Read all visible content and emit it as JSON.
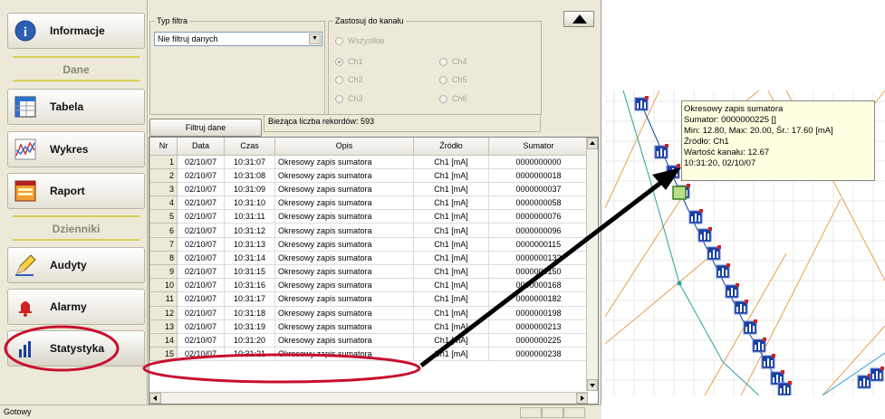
{
  "sidebar": {
    "info_label": "Informacje",
    "section_data": "Dane",
    "table_label": "Tabela",
    "chart_label": "Wykres",
    "report_label": "Raport",
    "section_logs": "Dzienniki",
    "audits_label": "Audyty",
    "alarms_label": "Alarmy",
    "stats_label": "Statystyka"
  },
  "filter": {
    "type_legend": "Typ filtra",
    "type_value": "Nie filtruj danych",
    "channel_legend": "Zastosuj do kanału",
    "all_label": "Wszystkie",
    "channels": [
      "Ch1",
      "Ch2",
      "Ch3",
      "Ch4",
      "Ch5",
      "Ch6"
    ],
    "apply_button": "Filtruj dane",
    "record_count": "Bieżąca liczba rekordów: 593"
  },
  "table": {
    "columns": [
      "Nr",
      "Data",
      "Czas",
      "Opis",
      "Źródło",
      "Sumator"
    ],
    "rows": [
      [
        "1",
        "02/10/07",
        "10:31:07",
        "Okresowy zapis sumatora",
        "Ch1 [mA]",
        "0000000000"
      ],
      [
        "2",
        "02/10/07",
        "10:31:08",
        "Okresowy zapis sumatora",
        "Ch1 [mA]",
        "0000000018"
      ],
      [
        "3",
        "02/10/07",
        "10:31:09",
        "Okresowy zapis sumatora",
        "Ch1 [mA]",
        "0000000037"
      ],
      [
        "4",
        "02/10/07",
        "10:31:10",
        "Okresowy zapis sumatora",
        "Ch1 [mA]",
        "0000000058"
      ],
      [
        "5",
        "02/10/07",
        "10:31:11",
        "Okresowy zapis sumatora",
        "Ch1 [mA]",
        "0000000076"
      ],
      [
        "6",
        "02/10/07",
        "10:31:12",
        "Okresowy zapis sumatora",
        "Ch1 [mA]",
        "0000000096"
      ],
      [
        "7",
        "02/10/07",
        "10:31:13",
        "Okresowy zapis sumatora",
        "Ch1 [mA]",
        "0000000115"
      ],
      [
        "8",
        "02/10/07",
        "10:31:14",
        "Okresowy zapis sumatora",
        "Ch1 [mA]",
        "0000000132"
      ],
      [
        "9",
        "02/10/07",
        "10:31:15",
        "Okresowy zapis sumatora",
        "Ch1 [mA]",
        "0000000150"
      ],
      [
        "10",
        "02/10/07",
        "10:31:16",
        "Okresowy zapis sumatora",
        "Ch1 [mA]",
        "0000000168"
      ],
      [
        "11",
        "02/10/07",
        "10:31:17",
        "Okresowy zapis sumatora",
        "Ch1 [mA]",
        "0000000182"
      ],
      [
        "12",
        "02/10/07",
        "10:31:18",
        "Okresowy zapis sumatora",
        "Ch1 [mA]",
        "0000000198"
      ],
      [
        "13",
        "02/10/07",
        "10:31:19",
        "Okresowy zapis sumatora",
        "Ch1 [mA]",
        "0000000213"
      ],
      [
        "14",
        "02/10/07",
        "10:31:20",
        "Okresowy zapis sumatora",
        "Ch1 [mA]",
        "0000000225"
      ],
      [
        "15",
        "02/10/07",
        "10:31:21",
        "Okresowy zapis sumatora",
        "Ch1 [mA]",
        "0000000238"
      ]
    ]
  },
  "status": {
    "text": "Gotowy"
  },
  "tooltip": {
    "lines": [
      "Okresowy zapis sumatora",
      "Sumator: 0000000225 []",
      "Min: 12.80, Max: 20.00, Śr.: 17.60 [mA]",
      "Źródło: Ch1",
      "Wartość kanału: 12.67",
      "10:31:20, 02/10/07"
    ]
  },
  "colors": {
    "highlight": "#c8102e",
    "marker": "#1a3fa0",
    "series_main": "#1a3fa0",
    "series_teal": "#2aa198",
    "series_orange": "#e8a050"
  }
}
